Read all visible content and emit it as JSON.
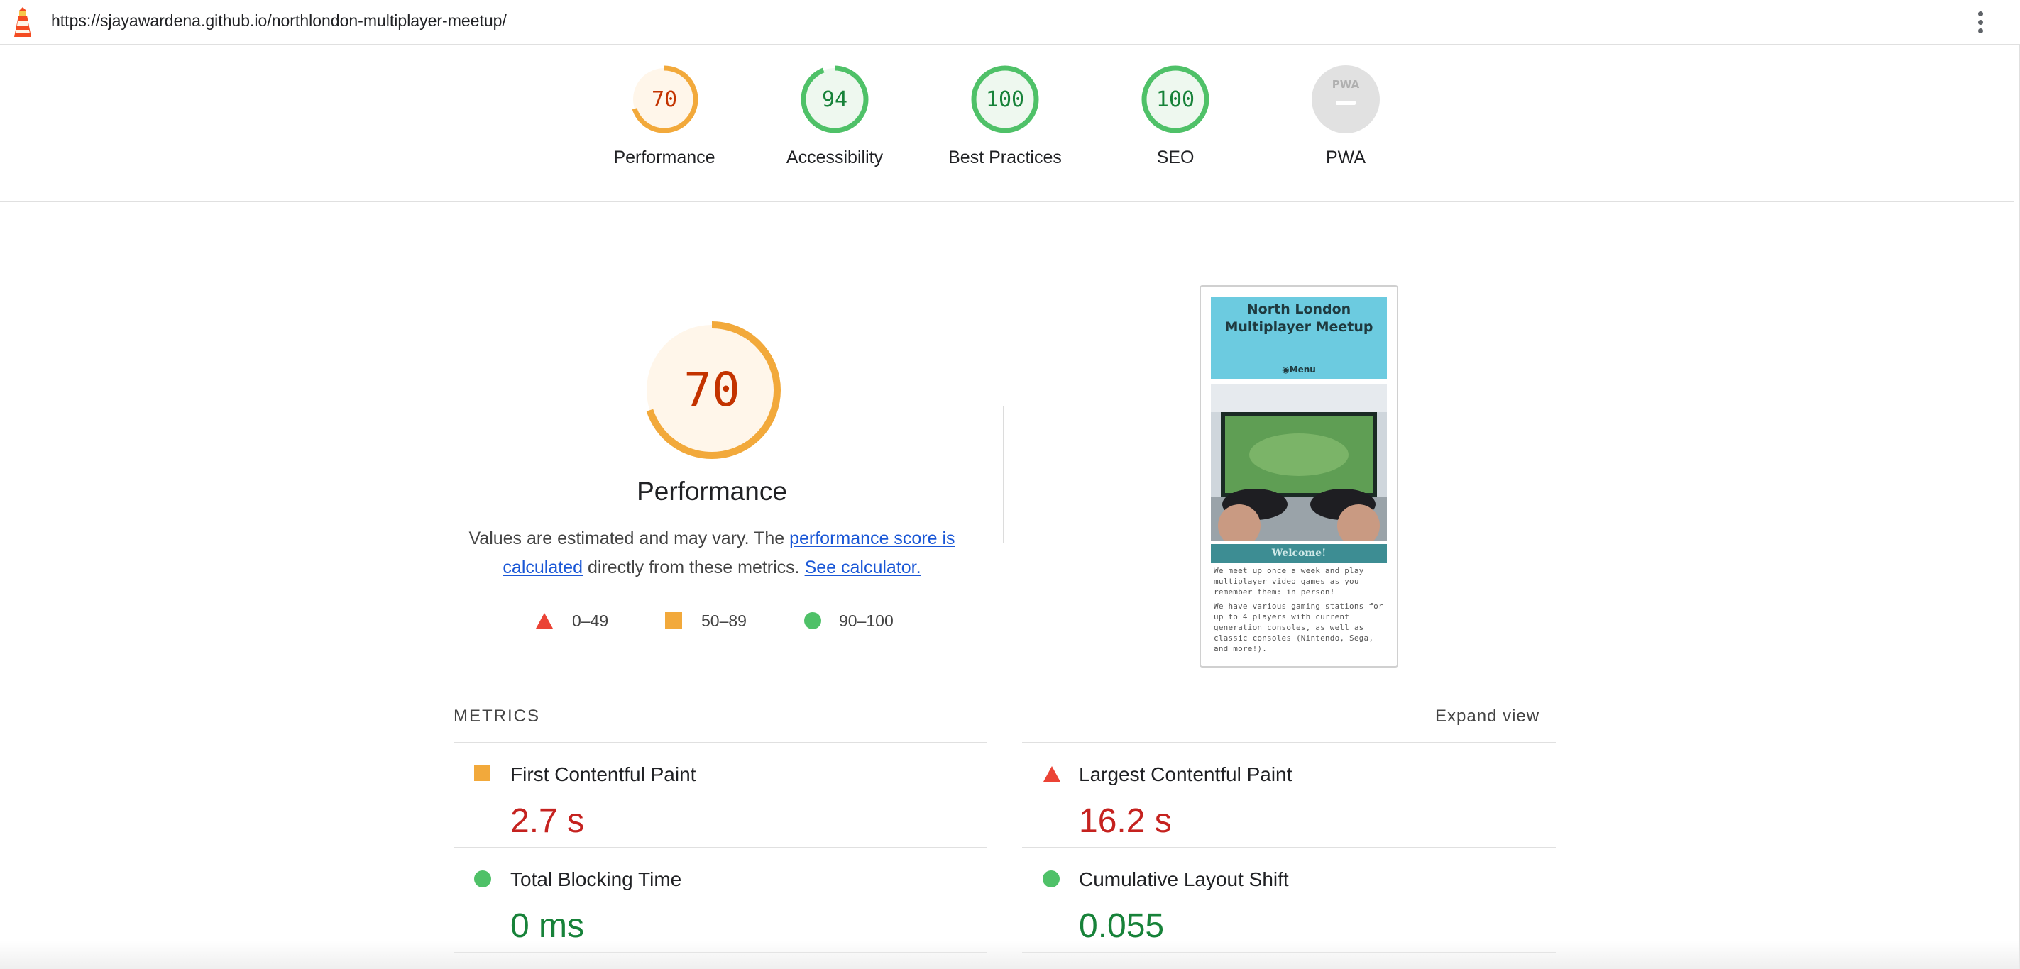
{
  "topbar": {
    "url": "https://sjayawardena.github.io/northlondon-multiplayer-meetup/",
    "logo_icon": "lighthouse-icon",
    "menu_icon": "more-vert-icon"
  },
  "categories": [
    {
      "label": "Performance",
      "score": "70",
      "fraction": 0.7,
      "status": "average"
    },
    {
      "label": "Accessibility",
      "score": "94",
      "fraction": 0.94,
      "status": "pass"
    },
    {
      "label": "Best Practices",
      "score": "100",
      "fraction": 1.0,
      "status": "pass"
    },
    {
      "label": "SEO",
      "score": "100",
      "fraction": 1.0,
      "status": "pass"
    },
    {
      "label": "PWA",
      "score": "",
      "badge_text": "PWA",
      "status": "na"
    }
  ],
  "performance": {
    "score": "70",
    "fraction": 0.7,
    "title": "Performance",
    "desc_prefix": "Values are estimated and may vary. The ",
    "desc_link1": "performance score is calculated",
    "desc_middle": " directly from these metrics. ",
    "desc_link2": "See calculator."
  },
  "legend": [
    {
      "range": "0–49",
      "shape": "triangle-icon",
      "color": "#eb4335"
    },
    {
      "range": "50–89",
      "shape": "square-icon",
      "color": "#f2a93b"
    },
    {
      "range": "90–100",
      "shape": "circle-icon",
      "color": "#4fc168"
    }
  ],
  "screenshot": {
    "title": "North London Multiplayer Meetup",
    "menu": "Menu",
    "welcome": "Welcome!",
    "p1": "We meet up once a week and play multiplayer video games as you remember them: in person!",
    "p2": "We have various gaming stations for up to 4 players with current generation consoles, as well as classic consoles (Nintendo, Sega, and more!)."
  },
  "metrics": {
    "label": "METRICS",
    "expand": "Expand view",
    "items": [
      {
        "name": "First Contentful Paint",
        "value": "2.7 s",
        "status": "average"
      },
      {
        "name": "Largest Contentful Paint",
        "value": "16.2 s",
        "status": "fail"
      },
      {
        "name": "Total Blocking Time",
        "value": "0 ms",
        "status": "pass"
      },
      {
        "name": "Cumulative Layout Shift",
        "value": "0.055",
        "status": "pass"
      }
    ]
  },
  "colors": {
    "fail": "#eb4335",
    "average": "#f2a93b",
    "pass": "#4fc168",
    "value_fail": "#c5221f",
    "value_pass": "#178239",
    "link": "#1a57d6"
  }
}
